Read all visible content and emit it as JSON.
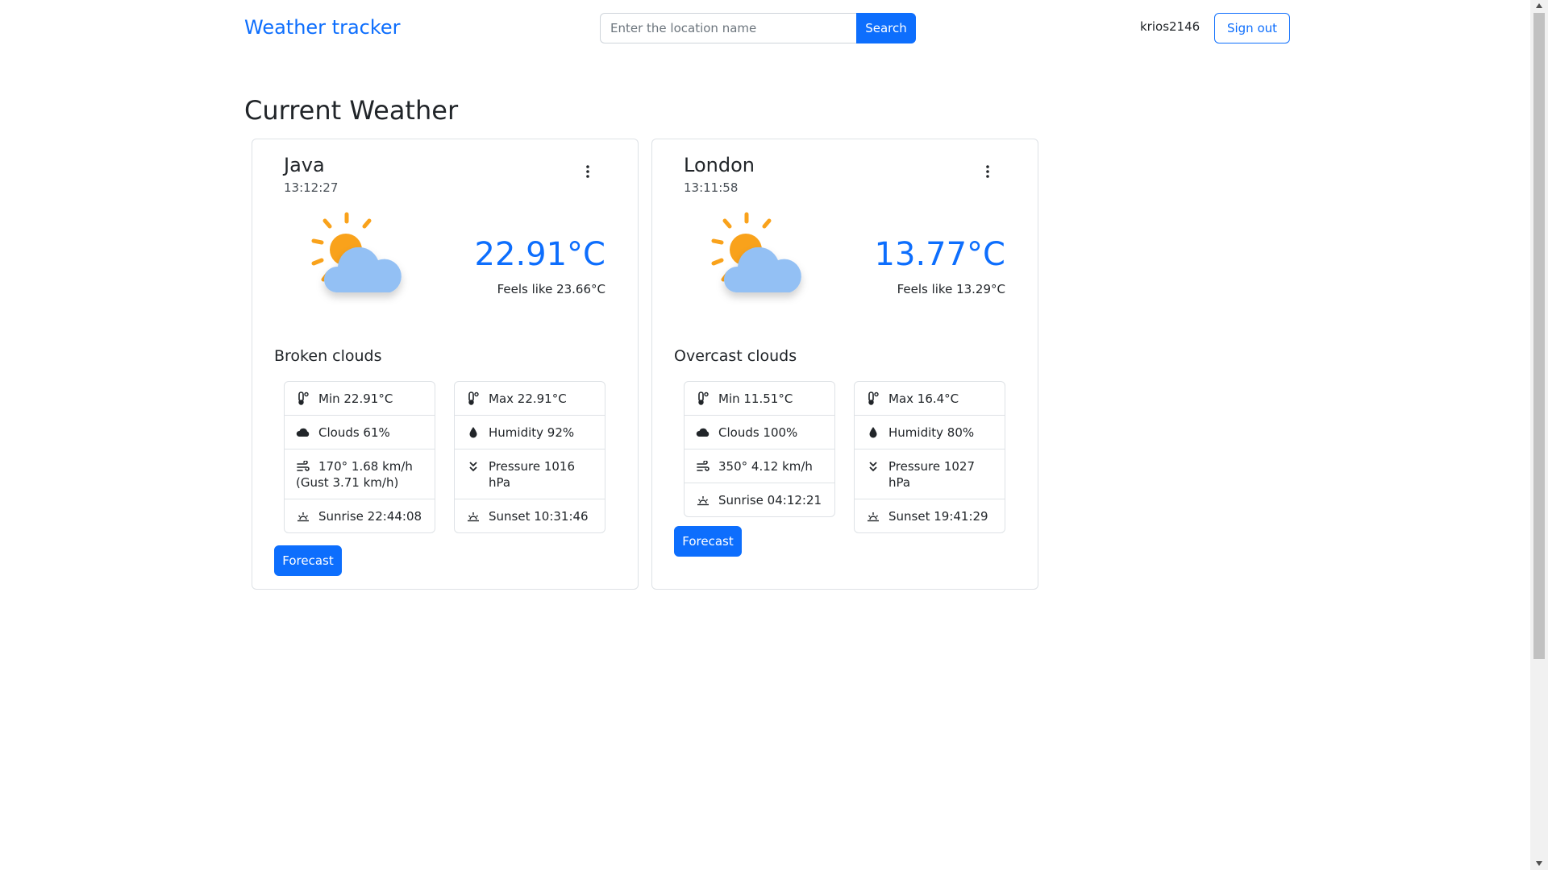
{
  "navbar": {
    "brand": "Weather tracker",
    "search": {
      "placeholder": "Enter the location name",
      "value": "",
      "button_label": "Search"
    },
    "username": "krios2146",
    "signout_label": "Sign out"
  },
  "page_title": "Current Weather",
  "cards": [
    {
      "city": "Java",
      "time": "13:12:27",
      "icon": "partly-cloudy-icon",
      "temp": "22.91°C",
      "feels_like": "Feels like 23.66°C",
      "description": "Broken clouds",
      "left_stats": [
        {
          "icon": "thermometer-icon",
          "text": "Min 22.91°C"
        },
        {
          "icon": "cloud-icon",
          "text": "Clouds 61%"
        },
        {
          "icon": "wind-icon",
          "text": "170° 1.68 km/h",
          "text2": "(Gust 3.71 km/h)"
        },
        {
          "icon": "sunrise-icon",
          "text": "Sunrise 22:44:08"
        }
      ],
      "right_stats": [
        {
          "icon": "thermometer-icon",
          "text": "Max 22.91°C"
        },
        {
          "icon": "droplet-icon",
          "text": "Humidity 92%"
        },
        {
          "icon": "pressure-icon",
          "text": "Pressure 1016 hPa"
        },
        {
          "icon": "sunset-icon",
          "text": "Sunset 10:31:46"
        }
      ],
      "forecast_label": "Forecast"
    },
    {
      "city": "London",
      "time": "13:11:58",
      "icon": "partly-cloudy-icon",
      "temp": "13.77°C",
      "feels_like": "Feels like 13.29°C",
      "description": "Overcast clouds",
      "left_stats": [
        {
          "icon": "thermometer-icon",
          "text": "Min 11.51°C"
        },
        {
          "icon": "cloud-icon",
          "text": "Clouds 100%"
        },
        {
          "icon": "wind-icon",
          "text": "350° 4.12 km/h"
        },
        {
          "icon": "sunrise-icon",
          "text": "Sunrise 04:12:21"
        }
      ],
      "right_stats": [
        {
          "icon": "thermometer-icon",
          "text": "Max 16.4°C"
        },
        {
          "icon": "droplet-icon",
          "text": "Humidity 80%"
        },
        {
          "icon": "pressure-icon",
          "text": "Pressure 1027 hPa"
        },
        {
          "icon": "sunset-icon",
          "text": "Sunset 19:41:29"
        }
      ],
      "forecast_label": "Forecast"
    }
  ],
  "colors": {
    "primary": "#0d6efd",
    "sun": "#f9a21b",
    "cloud": "#93c0f4",
    "border": "#dee2e6"
  }
}
